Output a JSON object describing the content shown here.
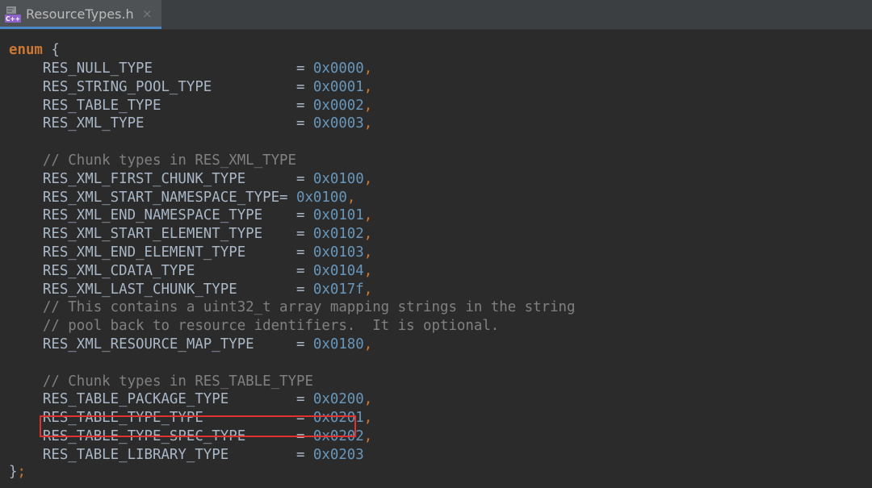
{
  "tab": {
    "title": "ResourceTypes.h",
    "close_glyph": "×",
    "icon_label": "C++"
  },
  "colors": {
    "keyword": "#cc7832",
    "number": "#6897bb",
    "comment": "#808080",
    "identifier": "#a9b7c6",
    "background": "#2b2b2b",
    "highlight_border": "#e0332f"
  },
  "code": {
    "enum_keyword": "enum",
    "open_brace": " {",
    "close_brace": "}",
    "close_semicolon": ";",
    "lines": [
      {
        "kind": "entry",
        "name": "    RES_NULL_TYPE                 = ",
        "value": "0x0000",
        "comma": ","
      },
      {
        "kind": "entry",
        "name": "    RES_STRING_POOL_TYPE          = ",
        "value": "0x0001",
        "comma": ","
      },
      {
        "kind": "entry",
        "name": "    RES_TABLE_TYPE                = ",
        "value": "0x0002",
        "comma": ","
      },
      {
        "kind": "entry",
        "name": "    RES_XML_TYPE                  = ",
        "value": "0x0003",
        "comma": ","
      },
      {
        "kind": "blank"
      },
      {
        "kind": "comment",
        "text": "    // Chunk types in RES_XML_TYPE"
      },
      {
        "kind": "entry",
        "name": "    RES_XML_FIRST_CHUNK_TYPE      = ",
        "value": "0x0100",
        "comma": ","
      },
      {
        "kind": "entry",
        "name": "    RES_XML_START_NAMESPACE_TYPE= ",
        "value": "0x0100",
        "comma": ","
      },
      {
        "kind": "entry",
        "name": "    RES_XML_END_NAMESPACE_TYPE    = ",
        "value": "0x0101",
        "comma": ","
      },
      {
        "kind": "entry",
        "name": "    RES_XML_START_ELEMENT_TYPE    = ",
        "value": "0x0102",
        "comma": ","
      },
      {
        "kind": "entry",
        "name": "    RES_XML_END_ELEMENT_TYPE      = ",
        "value": "0x0103",
        "comma": ","
      },
      {
        "kind": "entry",
        "name": "    RES_XML_CDATA_TYPE            = ",
        "value": "0x0104",
        "comma": ","
      },
      {
        "kind": "entry",
        "name": "    RES_XML_LAST_CHUNK_TYPE       = ",
        "value": "0x017f",
        "comma": ","
      },
      {
        "kind": "comment",
        "text": "    // This contains a uint32_t array mapping strings in the string"
      },
      {
        "kind": "comment",
        "text": "    // pool back to resource identifiers.  It is optional."
      },
      {
        "kind": "entry",
        "name": "    RES_XML_RESOURCE_MAP_TYPE     = ",
        "value": "0x0180",
        "comma": ","
      },
      {
        "kind": "blank"
      },
      {
        "kind": "comment",
        "text": "    // Chunk types in RES_TABLE_TYPE"
      },
      {
        "kind": "entry",
        "name": "    RES_TABLE_PACKAGE_TYPE        = ",
        "value": "0x0200",
        "comma": ","
      },
      {
        "kind": "entry",
        "name": "    RES_TABLE_TYPE_TYPE           = ",
        "value": "0x0201",
        "comma": ","
      },
      {
        "kind": "entry",
        "name": "    RES_TABLE_TYPE_SPEC_TYPE      = ",
        "value": "0x0202",
        "comma": ","
      },
      {
        "kind": "entry",
        "name": "    RES_TABLE_LIBRARY_TYPE        = ",
        "value": "0x0203",
        "comma": ""
      }
    ]
  }
}
